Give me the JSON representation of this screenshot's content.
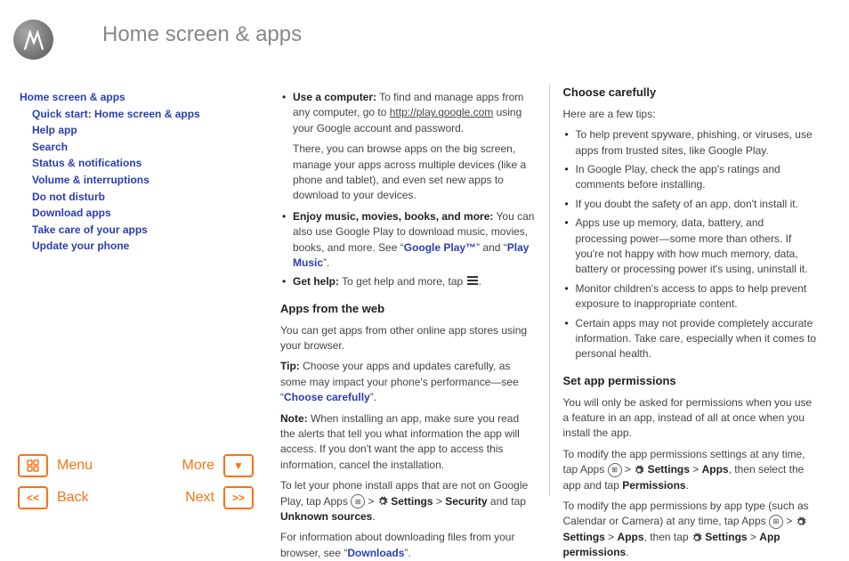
{
  "title": "Home screen & apps",
  "sidebar": {
    "heading": "Home screen & apps",
    "items": [
      "Quick start: Home screen & apps",
      "Help app",
      "Search",
      "Status & notifications",
      "Volume & interruptions",
      "Do not disturb",
      "Download apps",
      "Take care of your apps",
      "Update your phone"
    ]
  },
  "nav": {
    "menu": "Menu",
    "more": "More",
    "back": "Back",
    "next": "Next"
  },
  "col1": {
    "b1_bold": "Use a computer:",
    "b1_text": " To find and manage apps from any computer, go to ",
    "b1_link": "http://play.google.com",
    "b1_text2": " using your Google account and password.",
    "b1_p2": "There, you can browse apps on the big screen, manage your apps across multiple devices (like a phone and tablet), and even set new apps to download to your devices.",
    "b2_bold": "Enjoy music, movies, books, and more:",
    "b2_text": " You can also use Google Play to download music, movies, books, and more. See “",
    "b2_link1": "Google Play™",
    "b2_mid": "” and “",
    "b2_link2": "Play Music",
    "b2_end": "”.",
    "b3_bold": "Get help:",
    "b3_text": " To get help and more, tap ",
    "h1": "Apps from the web",
    "p1": "You can get apps from other online app stores using your browser.",
    "tip_label": "Tip:",
    "tip_text": " Choose your apps and updates carefully, as some may impact your phone's performance—see “",
    "tip_link": "Choose carefully",
    "tip_end": "”.",
    "note_label": "Note:",
    "note_text": " When installing an app, make sure you read the alerts that tell you what information the app will access. If you don't want the app to access this information, cancel the installation.",
    "p2a": "To let your phone install apps that are not on Google Play, tap Apps ",
    "p2b": " > ",
    "settings": "Settings",
    "security": "Security",
    "and_tap": " and tap ",
    "unknown": "Unknown sources",
    "p3a": "For information about downloading files from your browser, see “",
    "p3link": "Downloads",
    "p3b": "”."
  },
  "col2": {
    "h1": "Choose carefully",
    "intro": "Here are a few tips:",
    "tips": [
      "To help prevent spyware, phishing, or viruses, use apps from trusted sites, like Google Play.",
      "In Google Play, check the app's ratings and comments before installing.",
      "If you doubt the safety of an app, don't install it.",
      "Apps use up memory, data, battery, and processing power—some more than others. If you're not happy with how much memory, data, battery or processing power it's using, uninstall it.",
      "Monitor children's access to apps to help prevent exposure to inappropriate content.",
      "Certain apps may not provide completely accurate information. Take care, especially when it comes to personal health."
    ],
    "h2": "Set app permissions",
    "p1": "You will only be asked for permissions when you use a feature in an app, instead of all at once when you install the app.",
    "p2a": "To modify the app permissions settings at any time, tap Apps ",
    "gt": " > ",
    "settings": "Settings",
    "apps": "Apps",
    "p2b": ", then select the app and tap ",
    "perm": "Permissions",
    "p3a": "To modify the app permissions by app type (such as Calendar or Camera) at any time, tap Apps ",
    "p3b": ", then tap ",
    "appperm": "App permissions"
  }
}
